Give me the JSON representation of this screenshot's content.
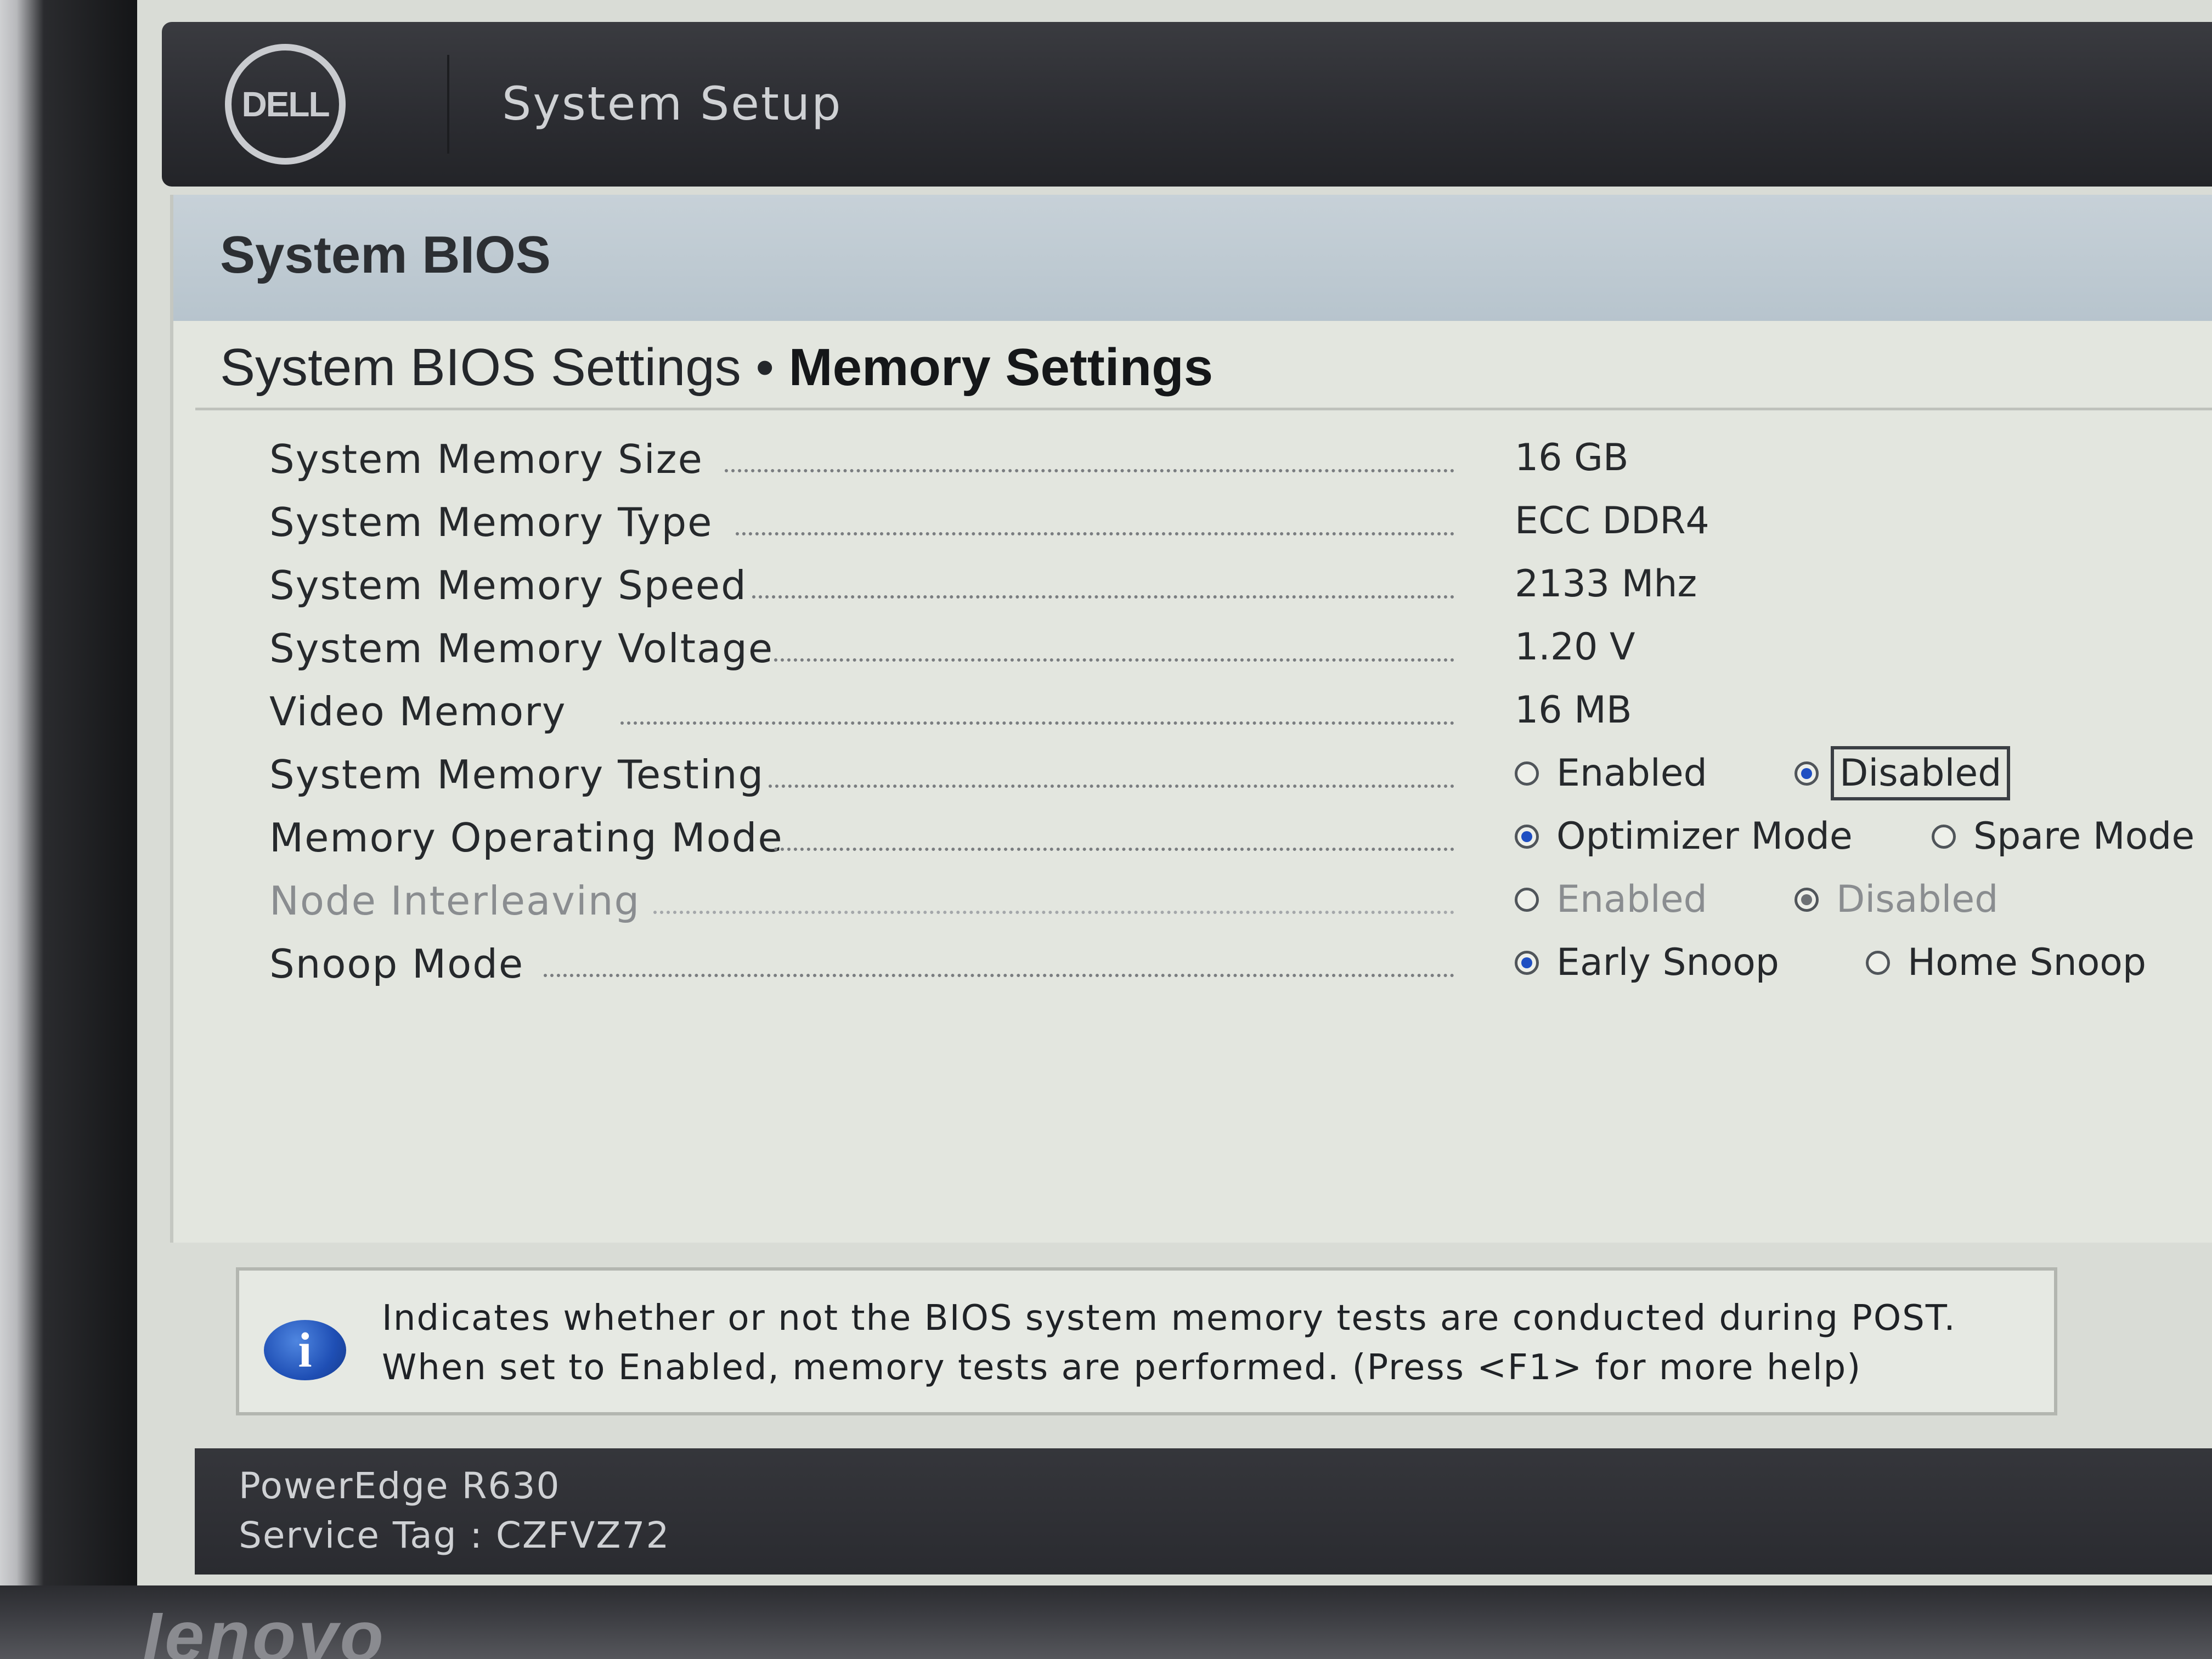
{
  "header": {
    "title": "System Setup",
    "logo_text": "DELL"
  },
  "panel": {
    "title": "System BIOS",
    "breadcrumb": {
      "parent": "System BIOS Settings",
      "separator": "•",
      "current": "Memory Settings"
    }
  },
  "settings": [
    {
      "label": "System Memory Size",
      "value": "16 GB"
    },
    {
      "label": "System Memory Type",
      "value": "ECC DDR4"
    },
    {
      "label": "System Memory Speed",
      "value": "2133 Mhz"
    },
    {
      "label": "System Memory Voltage",
      "value": "1.20 V"
    },
    {
      "label": "Video Memory",
      "value": "16 MB"
    },
    {
      "label": "System Memory Testing",
      "options": [
        "Enabled",
        "Disabled"
      ],
      "selected": "Disabled",
      "enabled": true
    },
    {
      "label": "Memory Operating Mode",
      "options": [
        "Optimizer Mode",
        "Spare Mode"
      ],
      "selected": "Optimizer Mode",
      "enabled": true
    },
    {
      "label": "Node Interleaving",
      "options": [
        "Enabled",
        "Disabled"
      ],
      "selected": "Disabled",
      "enabled": false
    },
    {
      "label": "Snoop Mode",
      "options": [
        "Early Snoop",
        "Home Snoop"
      ],
      "selected": "Early Snoop",
      "enabled": true
    }
  ],
  "help": {
    "icon": "info-icon",
    "icon_glyph": "i",
    "line1": "Indicates whether or not the BIOS system memory tests are conducted during POST.",
    "line2": "When set to Enabled, memory tests are performed. (Press <F1> for more help)"
  },
  "footer": {
    "model": "PowerEdge R630",
    "service_tag": "Service Tag : CZFVZ72"
  },
  "monitor": {
    "brand": "lenovo"
  },
  "colors": {
    "radio_selected": "#1f4fc2",
    "header_bg": "#2b2c31",
    "panel_bg": "#e3e6df",
    "band_bg": "#b7c4cd"
  }
}
